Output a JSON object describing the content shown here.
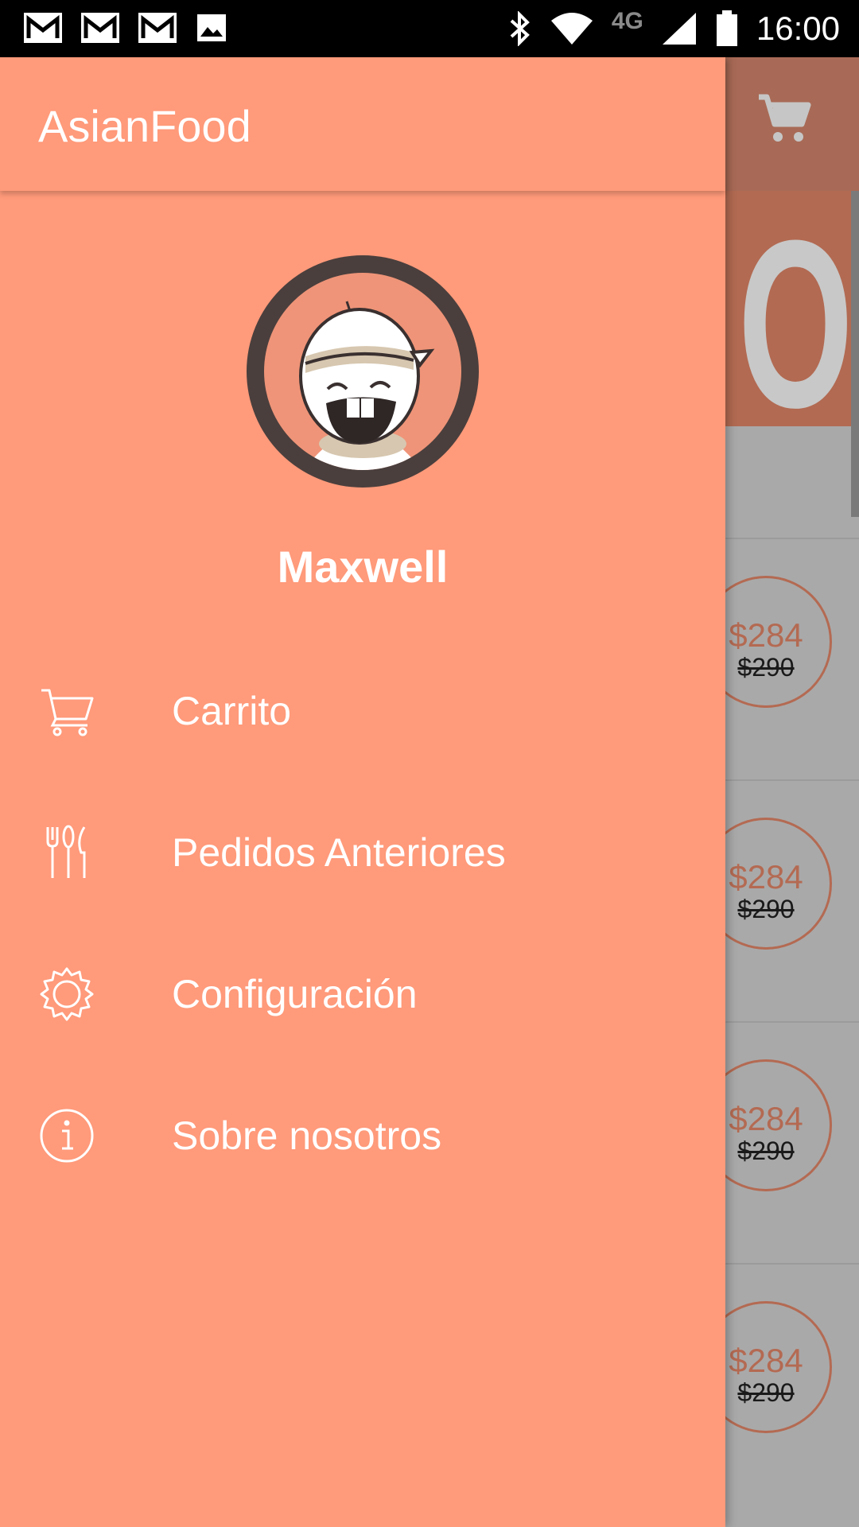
{
  "status_bar": {
    "time": "16:00",
    "network": "4G",
    "left_icons": [
      "gmail-icon",
      "gmail-icon",
      "gmail-icon",
      "image-icon"
    ],
    "right_icons": [
      "bluetooth-icon",
      "wifi-icon",
      "signal-icon",
      "battery-icon"
    ]
  },
  "drawer": {
    "title": "AsianFood",
    "user_name": "Maxwell",
    "items": [
      {
        "label": "Carrito",
        "icon": "cart-icon"
      },
      {
        "label": "Pedidos Anteriores",
        "icon": "cutlery-icon"
      },
      {
        "label": "Configuración",
        "icon": "gear-icon"
      },
      {
        "label": "Sobre nosotros",
        "icon": "info-icon"
      }
    ]
  },
  "background": {
    "banner_text": "OD",
    "products": [
      {
        "price": "$284",
        "old_price": "$290"
      },
      {
        "price": "$284",
        "old_price": "$290"
      },
      {
        "price": "$284",
        "old_price": "$290"
      },
      {
        "price": "$284",
        "old_price": "$290"
      }
    ]
  },
  "colors": {
    "drawer_bg": "#ff9a7a",
    "accent": "#b46a52",
    "scrim_bg": "#a9a9a9"
  }
}
